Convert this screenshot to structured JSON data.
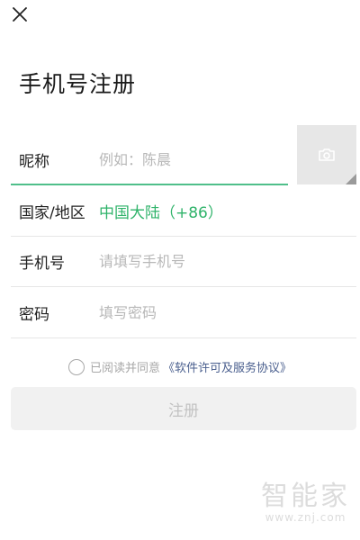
{
  "header": {
    "close_icon": "close-icon",
    "title": "手机号注册"
  },
  "form": {
    "nickname": {
      "label": "昵称",
      "placeholder": "例如：陈晨"
    },
    "avatar": {
      "icon": "camera-icon"
    },
    "region": {
      "label": "国家/地区",
      "value": "中国大陆（+86）"
    },
    "phone": {
      "label": "手机号",
      "placeholder": "请填写手机号"
    },
    "password": {
      "label": "密码",
      "placeholder": "填写密码"
    }
  },
  "agreement": {
    "text": "已阅读并同意",
    "link": "《软件许可及服务协议》",
    "checked": false
  },
  "register_button": {
    "label": "注册"
  },
  "watermark": {
    "logo": "智能家",
    "url": "www.znj.com"
  },
  "colors": {
    "accent_green": "#2fb36a",
    "input_underline": "#4fbf8a",
    "link_blue": "#4a5f8e",
    "disabled_button_bg": "#f1f1f1"
  }
}
